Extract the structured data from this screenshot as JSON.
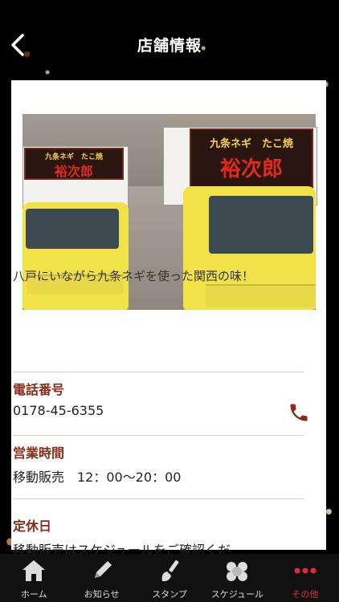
{
  "header": {
    "title": "店舗情報"
  },
  "content": {
    "intro": "八戸にいながら九条ネギを使った関西の味！",
    "phone": {
      "label": "電話番号",
      "value": "0178-45-6355"
    },
    "hours": {
      "label": "営業時間",
      "value": "移動販売　12：00〜20：00"
    },
    "closed": {
      "label": "定休日",
      "value": "移動販売はスケジュールをご確認くだ"
    },
    "photo": {
      "sign_small": "九条ネギ　たこ焼",
      "sign_big": "裕次郎"
    }
  },
  "tabbar": {
    "items": [
      {
        "label": "ホーム",
        "icon": "home-icon"
      },
      {
        "label": "お知らせ",
        "icon": "pencil-icon"
      },
      {
        "label": "スタンプ",
        "icon": "brush-icon"
      },
      {
        "label": "スケジュール",
        "icon": "takoyaki-icon"
      },
      {
        "label": "その他",
        "icon": "more-icon"
      }
    ],
    "active_index": 4,
    "active_color": "#e02b3a"
  }
}
